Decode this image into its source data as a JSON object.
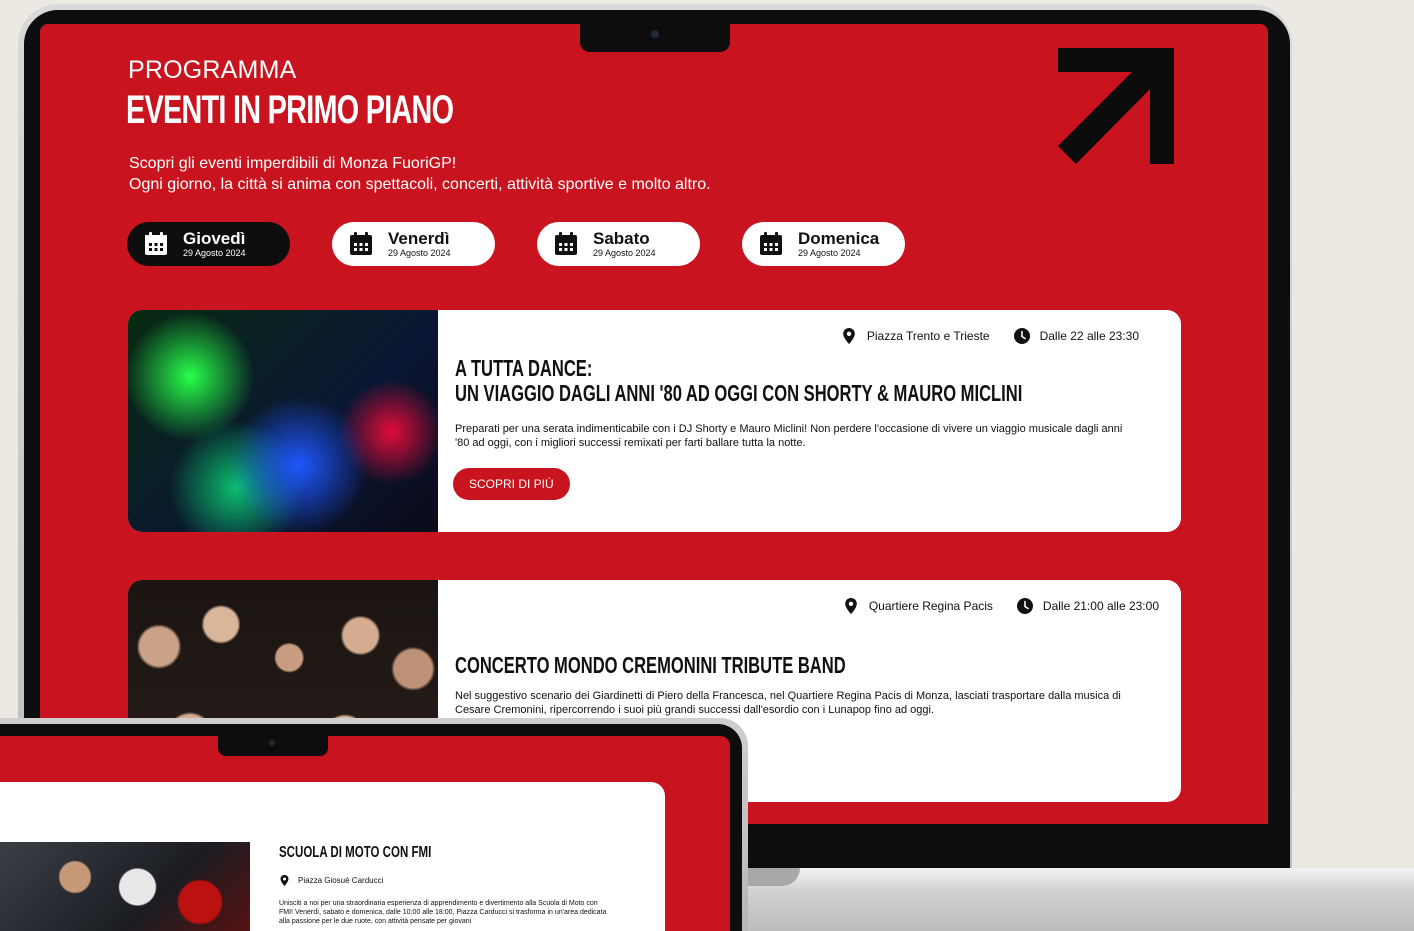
{
  "program": {
    "eyebrow": "PROGRAMMA",
    "headline": "EVENTI IN PRIMO PIANO",
    "intro_line1": "Scopri gli eventi imperdibili di Monza FuoriGP!",
    "intro_line2": "Ogni giorno, la città si anima con spettacoli, concerti, attività sportive e molto altro."
  },
  "days": [
    {
      "name": "Giovedì",
      "date": "29 Agosto 2024",
      "active": true
    },
    {
      "name": "Venerdì",
      "date": "29 Agosto 2024",
      "active": false
    },
    {
      "name": "Sabato",
      "date": "29 Agosto 2024",
      "active": false
    },
    {
      "name": "Domenica",
      "date": "29 Agosto 2024",
      "active": false
    }
  ],
  "events": [
    {
      "location": "Piazza Trento e Trieste",
      "time": "Dalle 22 alle 23:30",
      "title_line1": "A TUTTA DANCE:",
      "title_line2": "UN VIAGGIO DAGLI ANNI '80 AD OGGI CON SHORTY & MAURO MICLINI",
      "description": "Preparati per una serata indimenticabile con i DJ Shorty e Mauro Miclini! Non perdere l'occasione di vivere un viaggio musicale dagli anni '80 ad oggi, con i migliori successi remixati per farti ballare tutta la notte.",
      "cta": "SCOPRI DI PIÙ"
    },
    {
      "location": "Quartiere Regina Pacis",
      "time": "Dalle 21:00 alle 23:00",
      "title": "CONCERTO MONDO CREMONINI TRIBUTE BAND",
      "description": "Nel suggestivo scenario dei Giardinetti di Piero della Francesca, nel Quartiere Regina Pacis di Monza, lasciati trasportare dalla musica di Cesare Cremonini, ripercorrendo i suoi più grandi successi dall'esordio con i Lunapop fino ad oggi."
    }
  ],
  "mini_event": {
    "title": "SCUOLA DI MOTO CON FMI",
    "location": "Piazza Giosuè Carducci",
    "description": "Unisciti a noi per una straordinaria esperienza di apprendimento e divertimento alla Scuola di Moto con FMI! Venerdì, sabato e domenica, dalle 10:00 alle 18:00, Piazza Carducci si trasforma in un'area dedicata alla passione per le due ruote, con attività pensate per giovani"
  },
  "colors": {
    "brand_red": "#c9141f",
    "active_pill": "#0e0e0e",
    "page_bg": "#ece9e3"
  }
}
